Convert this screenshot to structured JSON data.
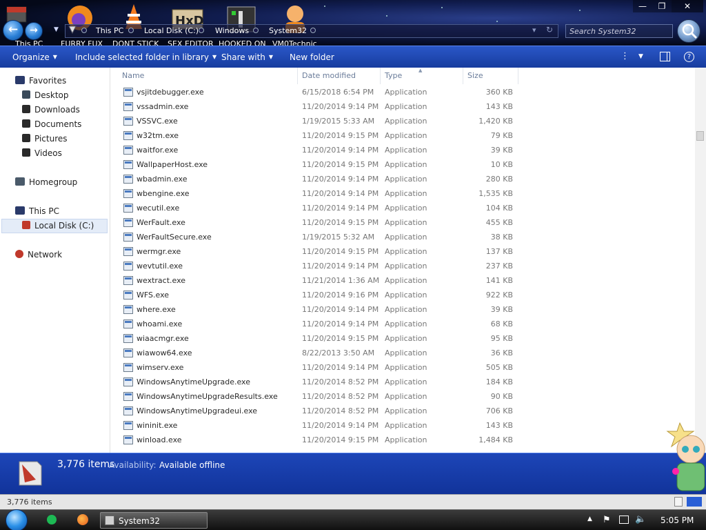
{
  "desktop": {
    "icons": [
      {
        "label": "This PC"
      },
      {
        "label": "FURRY FUX"
      },
      {
        "label": "DONT STICK"
      },
      {
        "label": "SEX EDITOR"
      },
      {
        "label": "HOOKED ON"
      },
      {
        "label": "VM0Technic"
      }
    ]
  },
  "window": {
    "controls": {
      "minimize": "—",
      "maximize": "❐",
      "close": "✕"
    }
  },
  "address_bar": {
    "breadcrumbs": [
      "This PC",
      "Local Disk (C:)",
      "Windows",
      "System32"
    ],
    "dropdown_icon": "▾",
    "refresh_icon": "↻"
  },
  "search": {
    "placeholder": "Search System32"
  },
  "command_bar": {
    "organize": "Organize",
    "include_library": "Include selected folder in library",
    "share_with": "Share with",
    "new_folder": "New folder",
    "help_icon": "?"
  },
  "nav": {
    "favorites": {
      "label": "Favorites",
      "items": [
        "Desktop",
        "Downloads",
        "Documents",
        "Pictures",
        "Videos"
      ]
    },
    "homegroup": "Homegroup",
    "this_pc": "This PC",
    "local_disk": "Local Disk (C:)",
    "network": "Network"
  },
  "columns": {
    "name": "Name",
    "date": "Date modified",
    "type": "Type",
    "size": "Size"
  },
  "files": [
    {
      "name": "vsjitdebugger.exe",
      "date": "6/15/2018 6:54 PM",
      "type": "Application",
      "size": "360 KB"
    },
    {
      "name": "vssadmin.exe",
      "date": "11/20/2014 9:14 PM",
      "type": "Application",
      "size": "143 KB"
    },
    {
      "name": "VSSVC.exe",
      "date": "1/19/2015 5:33 AM",
      "type": "Application",
      "size": "1,420 KB"
    },
    {
      "name": "w32tm.exe",
      "date": "11/20/2014 9:15 PM",
      "type": "Application",
      "size": "79 KB"
    },
    {
      "name": "waitfor.exe",
      "date": "11/20/2014 9:14 PM",
      "type": "Application",
      "size": "39 KB"
    },
    {
      "name": "WallpaperHost.exe",
      "date": "11/20/2014 9:15 PM",
      "type": "Application",
      "size": "10 KB"
    },
    {
      "name": "wbadmin.exe",
      "date": "11/20/2014 9:14 PM",
      "type": "Application",
      "size": "280 KB"
    },
    {
      "name": "wbengine.exe",
      "date": "11/20/2014 9:14 PM",
      "type": "Application",
      "size": "1,535 KB"
    },
    {
      "name": "wecutil.exe",
      "date": "11/20/2014 9:14 PM",
      "type": "Application",
      "size": "104 KB"
    },
    {
      "name": "WerFault.exe",
      "date": "11/20/2014 9:15 PM",
      "type": "Application",
      "size": "455 KB"
    },
    {
      "name": "WerFaultSecure.exe",
      "date": "1/19/2015 5:32 AM",
      "type": "Application",
      "size": "38 KB"
    },
    {
      "name": "wermgr.exe",
      "date": "11/20/2014 9:15 PM",
      "type": "Application",
      "size": "137 KB"
    },
    {
      "name": "wevtutil.exe",
      "date": "11/20/2014 9:14 PM",
      "type": "Application",
      "size": "237 KB"
    },
    {
      "name": "wextract.exe",
      "date": "11/21/2014 1:36 AM",
      "type": "Application",
      "size": "141 KB"
    },
    {
      "name": "WFS.exe",
      "date": "11/20/2014 9:16 PM",
      "type": "Application",
      "size": "922 KB"
    },
    {
      "name": "where.exe",
      "date": "11/20/2014 9:14 PM",
      "type": "Application",
      "size": "39 KB"
    },
    {
      "name": "whoami.exe",
      "date": "11/20/2014 9:14 PM",
      "type": "Application",
      "size": "68 KB"
    },
    {
      "name": "wiaacmgr.exe",
      "date": "11/20/2014 9:15 PM",
      "type": "Application",
      "size": "95 KB"
    },
    {
      "name": "wiawow64.exe",
      "date": "8/22/2013 3:50 AM",
      "type": "Application",
      "size": "36 KB"
    },
    {
      "name": "wimserv.exe",
      "date": "11/20/2014 9:14 PM",
      "type": "Application",
      "size": "505 KB"
    },
    {
      "name": "WindowsAnytimeUpgrade.exe",
      "date": "11/20/2014 8:52 PM",
      "type": "Application",
      "size": "184 KB"
    },
    {
      "name": "WindowsAnytimeUpgradeResults.exe",
      "date": "11/20/2014 8:52 PM",
      "type": "Application",
      "size": "90 KB"
    },
    {
      "name": "WindowsAnytimeUpgradeui.exe",
      "date": "11/20/2014 8:52 PM",
      "type": "Application",
      "size": "706 KB"
    },
    {
      "name": "wininit.exe",
      "date": "11/20/2014 9:14 PM",
      "type": "Application",
      "size": "143 KB"
    },
    {
      "name": "winload.exe",
      "date": "11/20/2014 9:15 PM",
      "type": "Application",
      "size": "1,484 KB"
    }
  ],
  "details_pane": {
    "count": "3,776 items",
    "availability_label": "Availability:",
    "availability_value": "Available offline"
  },
  "status_bar": {
    "count": "3,776 items"
  },
  "taskbar": {
    "window_label": "System32",
    "clock": "5:05 PM"
  },
  "colors": {
    "command_bar": "#1f46b5",
    "details_pane": "#1a40ae",
    "selection": "#e4ecf8"
  }
}
